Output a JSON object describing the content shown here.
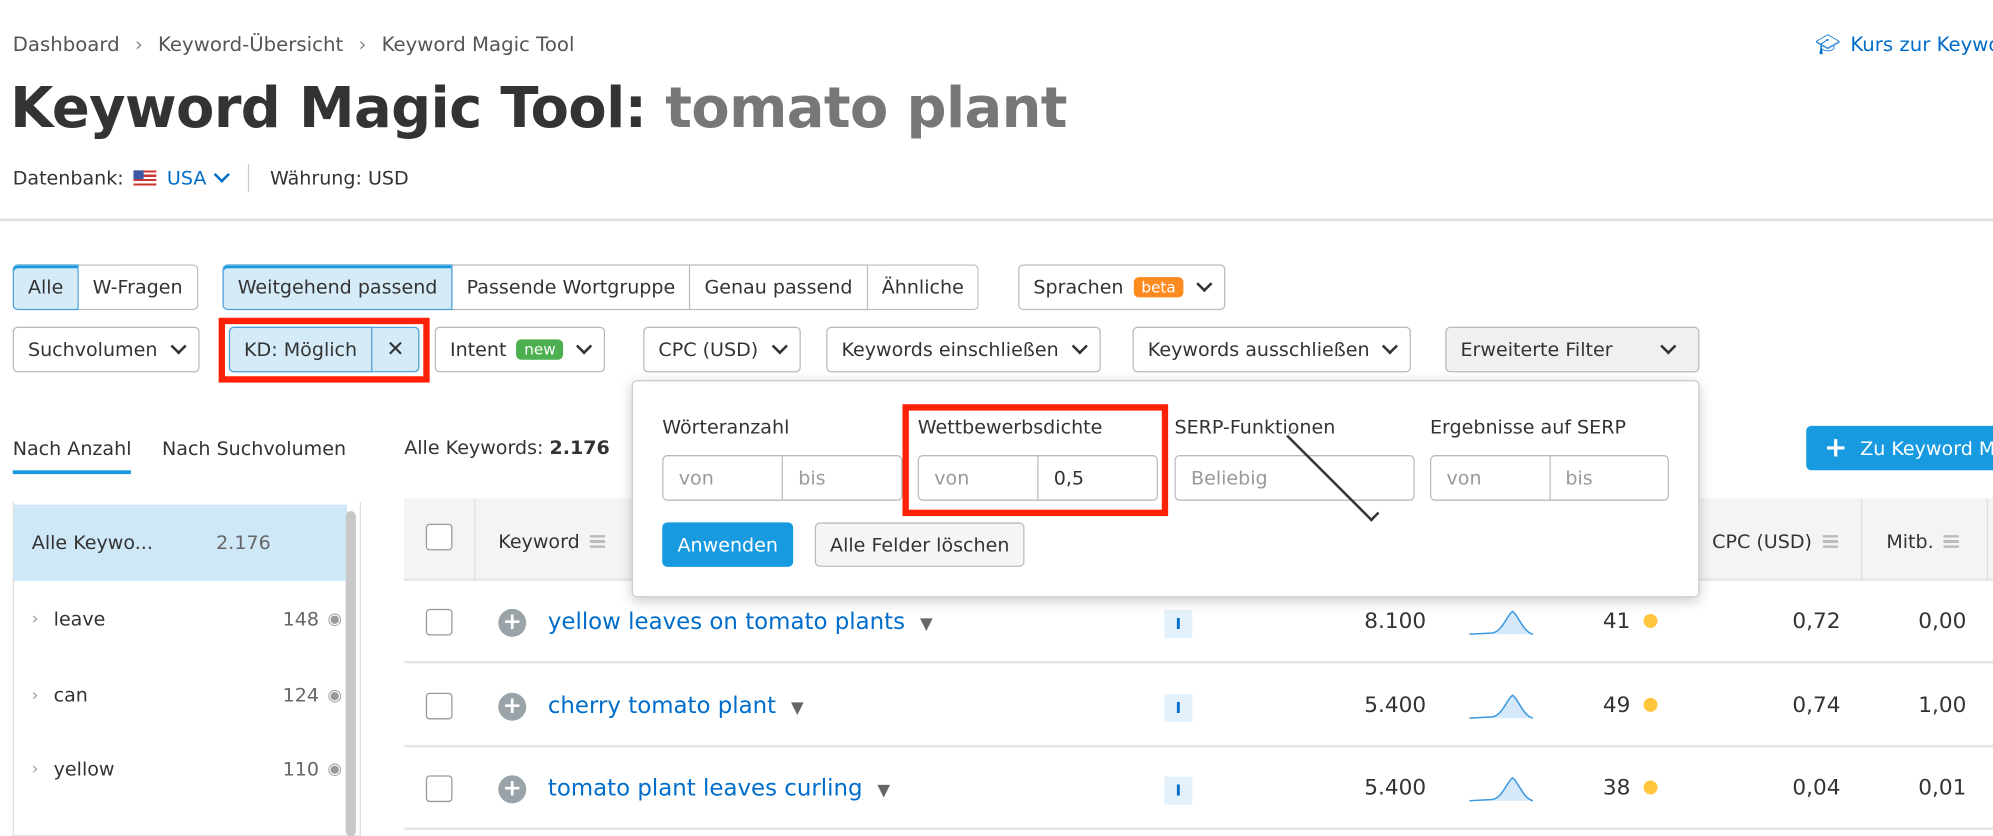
{
  "breadcrumb": [
    "Dashboard",
    "Keyword-Übersicht",
    "Keyword Magic Tool"
  ],
  "course_link": "Kurs zur Keywo",
  "title": {
    "tool": "Keyword Magic Tool:",
    "query": "tomato plant"
  },
  "database": {
    "label": "Datenbank:",
    "value": "USA",
    "currency": "Währung: USD"
  },
  "match_tabs": {
    "all": "Alle",
    "questions": "W-Fragen",
    "broad": "Weitgehend passend",
    "phrase": "Passende Wortgruppe",
    "exact": "Genau passend",
    "related": "Ähnliche",
    "languages": "Sprachen",
    "beta": "beta"
  },
  "filters": {
    "volume": "Suchvolumen",
    "kd": "KD: Möglich",
    "kd_clear": "✕",
    "intent": "Intent",
    "new": "new",
    "cpc": "CPC (USD)",
    "include": "Keywords einschließen",
    "exclude": "Keywords ausschließen",
    "advanced": "Erweiterte Filter"
  },
  "popup": {
    "word_count": "Wörteranzahl",
    "density": "Wettbewerbsdichte",
    "serp": "SERP-Funktionen",
    "results": "Ergebnisse auf SERP",
    "from": "von",
    "to": "bis",
    "density_to": "0,5",
    "serp_value": "Beliebig",
    "apply": "Anwenden",
    "clear": "Alle Felder löschen"
  },
  "side_tabs": {
    "by_count": "Nach Anzahl",
    "by_volume": "Nach Suchvolumen"
  },
  "all_keywords": {
    "label": "Alle Keywords:",
    "value": "2.176"
  },
  "add_button": "Zu Keyword M",
  "sidebar": [
    {
      "label": "Alle Keywo...",
      "count": "2.176"
    },
    {
      "label": "leave",
      "count": "148"
    },
    {
      "label": "can",
      "count": "124"
    },
    {
      "label": "yellow",
      "count": "110"
    }
  ],
  "table": {
    "headers": {
      "keyword": "Keyword",
      "cpc": "CPC (USD)",
      "comp": "Mitb."
    },
    "rows": [
      {
        "keyword": "yellow leaves on tomato plants",
        "intent": "I",
        "volume": "8.100",
        "kd": "41",
        "cpc": "0,72",
        "comp": "0,00"
      },
      {
        "keyword": "cherry tomato plant",
        "intent": "I",
        "volume": "5.400",
        "kd": "49",
        "cpc": "0,74",
        "comp": "1,00"
      },
      {
        "keyword": "tomato plant leaves curling",
        "intent": "I",
        "volume": "5.400",
        "kd": "38",
        "cpc": "0,04",
        "comp": "0,01"
      }
    ]
  },
  "colors": {
    "accent": "#189ae0",
    "link": "#006dca",
    "highlight": "#ff2008",
    "beta": "#ff8a1f",
    "new": "#4caf50",
    "kd_dot": "#ffc53d"
  }
}
